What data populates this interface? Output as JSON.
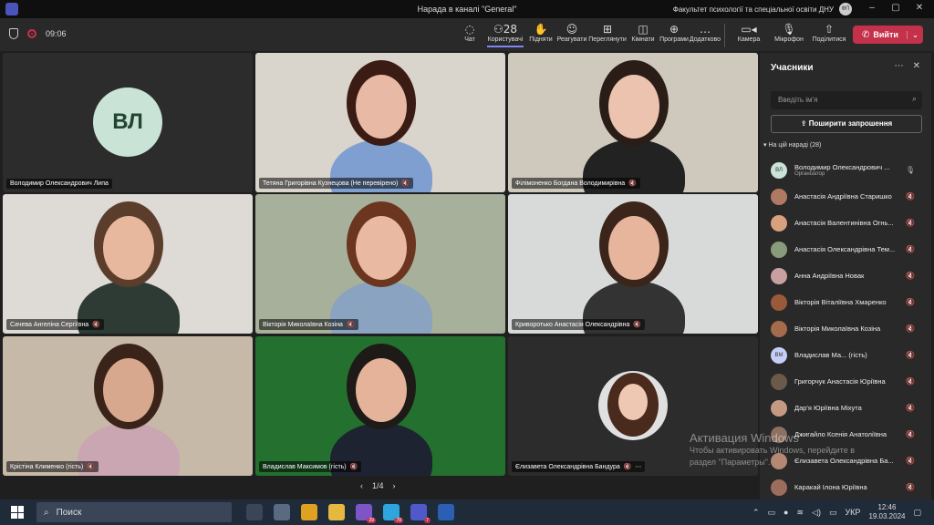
{
  "window": {
    "title": "Нарада в каналі \"General\"",
    "org": "Факультет психології та спеціальної освіти ДНУ",
    "org_avatar": "ФП"
  },
  "toolbar": {
    "timer": "09:06",
    "items": [
      {
        "label": "Чат",
        "icon": "chat-icon",
        "glyph": "◌"
      },
      {
        "label": "Користувачі",
        "icon": "people-icon",
        "glyph": "⚇28"
      },
      {
        "label": "Підняти",
        "icon": "raise-hand-icon",
        "glyph": "✋"
      },
      {
        "label": "Реагувати",
        "icon": "react-icon",
        "glyph": "☺"
      },
      {
        "label": "Переглянути",
        "icon": "view-icon",
        "glyph": "⊞"
      },
      {
        "label": "Кімнати",
        "icon": "rooms-icon",
        "glyph": "◫"
      },
      {
        "label": "Програми",
        "icon": "apps-icon",
        "glyph": "⊕"
      },
      {
        "label": "Додатково",
        "icon": "more-icon",
        "glyph": "…"
      }
    ],
    "camera_label": "Камера",
    "mic_label": "Мікрофон",
    "share_label": "Поділитися",
    "leave_label": "Вийти"
  },
  "tiles": [
    {
      "name": "Володимир Олександрович Липа",
      "initials": "ВЛ",
      "bg": "#2c2c2c",
      "type": "avatar"
    },
    {
      "name": "Тетяна Григорівна Кузнецова (Не перевірено)",
      "bg": "#d9d4cc",
      "type": "video",
      "hair": "#3a1c14",
      "skin": "#e8b9a4",
      "shirt": "#7f9fd0"
    },
    {
      "name": "Філімоненко Богдана Володимирівна",
      "bg": "#cfc9bd",
      "type": "video",
      "hair": "#2a1d17",
      "skin": "#ecc3ae",
      "shirt": "#222222"
    },
    {
      "name": "Сачева Ангеліна Сергіївна",
      "bg": "#dedad6",
      "type": "video",
      "hair": "#5b3d2c",
      "skin": "#e7b89d",
      "shirt": "#2e3b34"
    },
    {
      "name": "Вікторія Миколаївна Козіна",
      "bg": "#a7b09a",
      "type": "video",
      "hair": "#6b3520",
      "skin": "#eab9a1",
      "shirt": "#8aa3c0"
    },
    {
      "name": "Криворотько Анастасія Олександрівна",
      "bg": "#d8d9d9",
      "type": "video",
      "hair": "#3b241a",
      "skin": "#e6b59b",
      "shirt": "#333333"
    },
    {
      "name": "Крістіна Клименко (гість)",
      "bg": "#c7b9a8",
      "type": "video",
      "hair": "#3a2318",
      "skin": "#d8a88e",
      "shirt": "#caa5b2"
    },
    {
      "name": "Владислав Максимов (гість)",
      "bg": "#23702f",
      "type": "video",
      "hair": "#1e1a17",
      "skin": "#e4b39a",
      "shirt": "#1d2330"
    },
    {
      "name": "Єлизавета Олександрівна Бандура",
      "bg": "#2c2c2c",
      "type": "photo",
      "hair": "#4a2a1d",
      "skin": "#efc8b3",
      "shirt": "#e0e0e0"
    }
  ],
  "pager": {
    "prev": "‹",
    "text": "1/4",
    "next": "›"
  },
  "panel": {
    "title": "Учасники",
    "search_placeholder": "Введіть ім'я",
    "share_invite": "Поширити запрошення",
    "section": "На цій нараді (28)",
    "participants": [
      {
        "name": "Володимир Олександрович ...",
        "sub": "Організатор",
        "initials": "ВЛ",
        "color": "#c9e4d6",
        "mic": "🎙"
      },
      {
        "name": "Анастасія Андріївна Старишко",
        "sub": "",
        "initials": "",
        "color": "#b07a62",
        "mic": "🔇"
      },
      {
        "name": "Анастасія Валентинівна Огнь...",
        "sub": "",
        "initials": "",
        "color": "#d7a07e",
        "mic": "🔇"
      },
      {
        "name": "Анастасія Олександрівна Тем...",
        "sub": "",
        "initials": "",
        "color": "#8a9b7b",
        "mic": "🔇"
      },
      {
        "name": "Анна Андріївна Новак",
        "sub": "",
        "initials": "",
        "color": "#c8a0a0",
        "mic": "🔇"
      },
      {
        "name": "Вікторія Віталіївна Хмаренко",
        "sub": "",
        "initials": "",
        "color": "#9a5a3a",
        "mic": "🔇"
      },
      {
        "name": "Вікторія Миколаївна Козіна",
        "sub": "",
        "initials": "",
        "color": "#a46b4c",
        "mic": "🔇"
      },
      {
        "name": "Владислав Ма... (гість)",
        "sub": "",
        "initials": "ВМ",
        "color": "#c5cff5",
        "mic": "🔇"
      },
      {
        "name": "Григорчук Анастасія Юріївна",
        "sub": "",
        "initials": "",
        "color": "#6b5a4a",
        "mic": "🔇"
      },
      {
        "name": "Дар'я Юріївна Міхута",
        "sub": "",
        "initials": "",
        "color": "#c49a82",
        "mic": "🔇"
      },
      {
        "name": "Джигайло Ксенія Анатоліївна",
        "sub": "",
        "initials": "",
        "color": "#8c7060",
        "mic": "🔇"
      },
      {
        "name": "Єлизавета Олександрівна Ба...",
        "sub": "",
        "initials": "",
        "color": "#b58873",
        "mic": "🔇"
      },
      {
        "name": "Каракай Ілона Юріївна",
        "sub": "",
        "initials": "",
        "color": "#9c6d5d",
        "mic": "🔇"
      }
    ]
  },
  "watermark": {
    "line1": "Активация Windows",
    "line2": "Чтобы активировать Windows, перейдите в",
    "line3": "раздел \"Параметры\"."
  },
  "taskbar": {
    "search": "Поиск",
    "apps": [
      {
        "icon": "taskview-icon",
        "color": "#3a4557",
        "badge": ""
      },
      {
        "icon": "calculator-icon",
        "color": "#5a6a80",
        "badge": ""
      },
      {
        "icon": "chrome-icon",
        "color": "#e0a020",
        "badge": ""
      },
      {
        "icon": "explorer-icon",
        "color": "#e6b840",
        "badge": ""
      },
      {
        "icon": "viber-icon",
        "color": "#7d55c7",
        "badge": "39"
      },
      {
        "icon": "telegram-icon",
        "color": "#2ea6dd",
        "badge": "78"
      },
      {
        "icon": "teams-icon",
        "color": "#5059c9",
        "badge": "7"
      },
      {
        "icon": "word-icon",
        "color": "#2b5fb4",
        "badge": ""
      }
    ],
    "lang": "УКР",
    "time": "12:46",
    "date": "19.03.2024"
  }
}
